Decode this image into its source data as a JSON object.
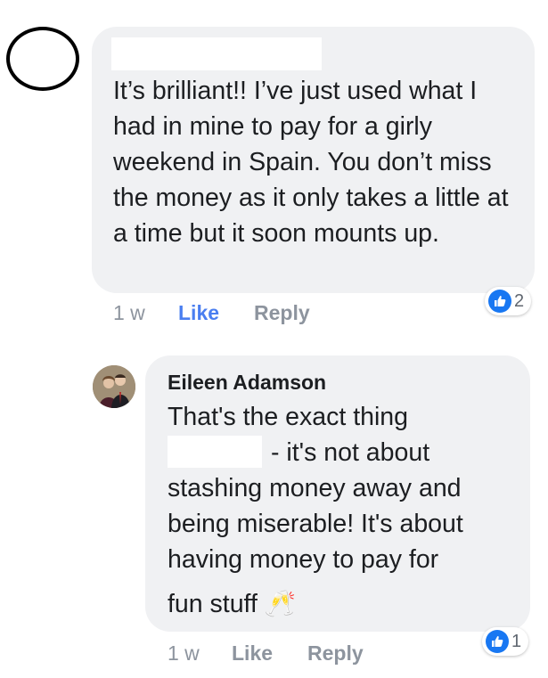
{
  "comment1": {
    "text": "It’s brilliant!! I’ve just used what I had in mine to pay for a girly weekend in Spain. You don’t miss the money as it only takes a little at a time but it soon mounts up.",
    "time": "1 w",
    "like_label": "Like",
    "reply_label": "Reply",
    "reaction_count": "2"
  },
  "reply1": {
    "author": "Eileen Adamson",
    "text_line1": "That's the exact thing",
    "text_line2": "- it's not about",
    "text_line3": "stashing money away and",
    "text_line4": "being miserable! It's about",
    "text_line5": "having money to pay for",
    "text_line6": "fun stuff",
    "emoji": "🥂",
    "time": "1 w",
    "like_label": "Like",
    "reply_label": "Reply",
    "reaction_count": "1"
  },
  "colors": {
    "bubble": "#f0f1f3",
    "like_active": "#4a7ef0",
    "muted": "#8d949e",
    "thumb": "#1877f2"
  }
}
